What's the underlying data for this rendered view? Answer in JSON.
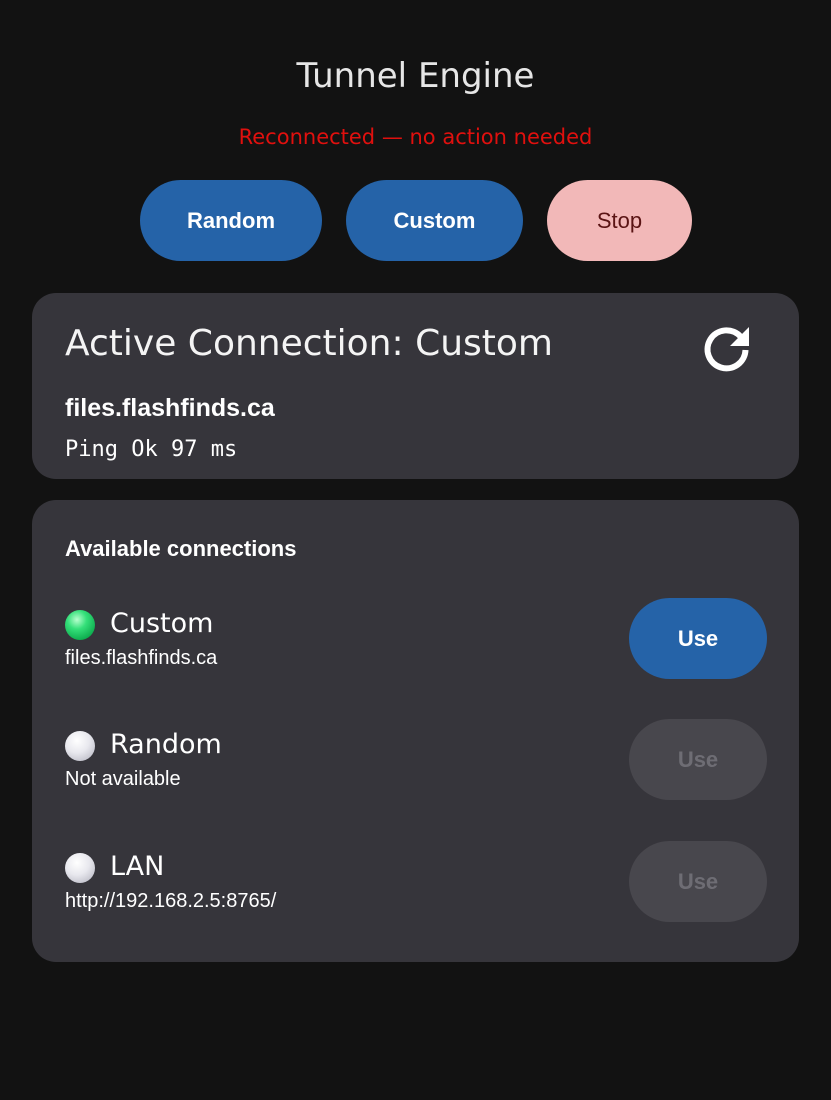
{
  "app": {
    "title": "Tunnel Engine",
    "status": "Reconnected — no action needed"
  },
  "mode_buttons": {
    "random": "Random",
    "custom": "Custom",
    "stop": "Stop"
  },
  "active_connection": {
    "title": "Active Connection: Custom",
    "host": "files.flashfinds.ca",
    "ping": "Ping Ok 97 ms",
    "refresh_icon": "refresh-icon"
  },
  "available": {
    "heading": "Available connections",
    "connections": [
      {
        "name": "Custom",
        "detail": "files.flashfinds.ca",
        "status": "active",
        "use_label": "Use",
        "enabled": true
      },
      {
        "name": "Random",
        "detail": "Not available",
        "status": "idle",
        "use_label": "Use",
        "enabled": false
      },
      {
        "name": "LAN",
        "detail": "http://192.168.2.5:8765/",
        "status": "idle",
        "use_label": "Use",
        "enabled": false
      }
    ]
  },
  "colors": {
    "background": "#121212",
    "card": "#36353b",
    "primary_button": "#2563a8",
    "stop_button": "#f2b8b8",
    "status_text": "#e0100e",
    "disabled_button": "#48474d"
  }
}
